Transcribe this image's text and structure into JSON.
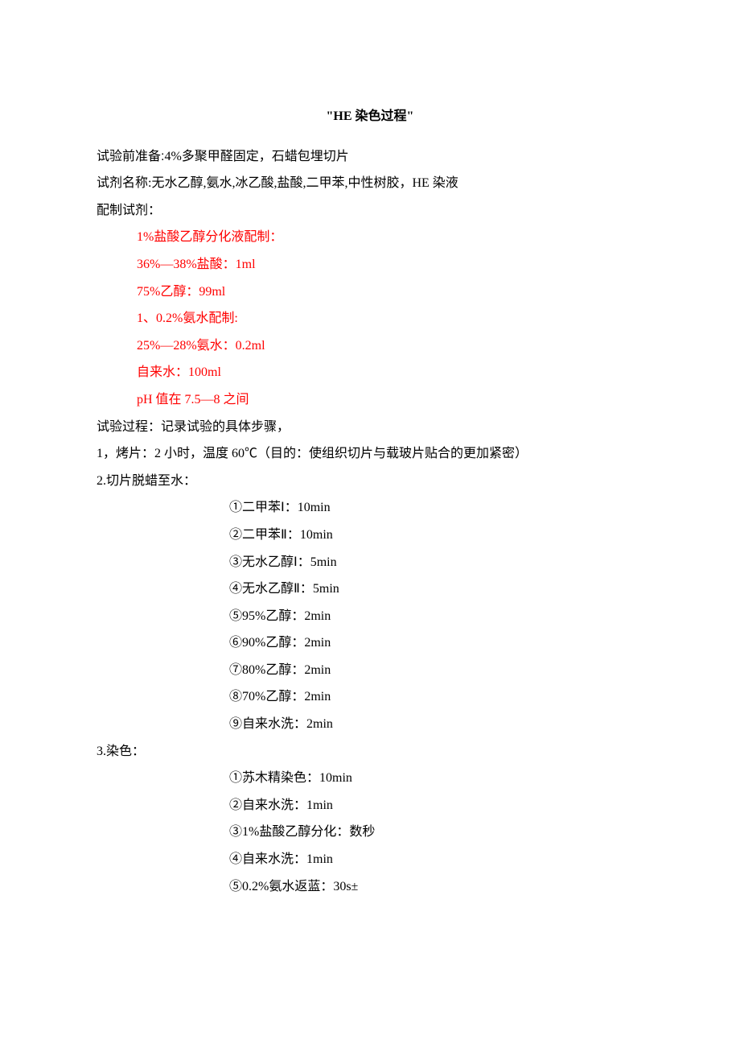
{
  "title": "\"HE 染色过程\"",
  "preparation": {
    "label": "试验前准备:",
    "text": "4%多聚甲醛固定，石蜡包埋切片"
  },
  "reagentNames": "试剂名称:无水乙醇,氨水,冰乙酸,盐酸,二甲苯,中性树胶，HE 染液",
  "reagentPrepLabel": "配制试剂：",
  "redLines": [
    "1%盐酸乙醇分化液配制：",
    "36%—38%盐酸：1ml",
    "75%乙醇：99ml",
    "1、0.2%氨水配制:",
    "25%—28%氨水：0.2ml",
    "自来水：100ml",
    "pH 值在 7.5—8 之间"
  ],
  "processLabel": "试验过程：记录试验的具体步骤，",
  "step1": "1，烤片：2 小时，温度 60℃（目的：使组织切片与载玻片贴合的更加紧密）",
  "step2Label": "2.切片脱蜡至水：",
  "step2Items": [
    "①二甲苯Ⅰ：10min",
    "②二甲苯Ⅱ：10min",
    "③无水乙醇Ⅰ：5min",
    "④无水乙醇Ⅱ：5min",
    "⑤95%乙醇：2min",
    "⑥90%乙醇：2min",
    "⑦80%乙醇：2min",
    "⑧70%乙醇：2min",
    "⑨自来水洗：2min"
  ],
  "step3Label": "3.染色：",
  "step3Items": [
    "①苏木精染色：10min",
    "②自来水洗：1min",
    "③1%盐酸乙醇分化：数秒",
    "④自来水洗：1min",
    "⑤0.2%氨水返蓝：30s±"
  ]
}
